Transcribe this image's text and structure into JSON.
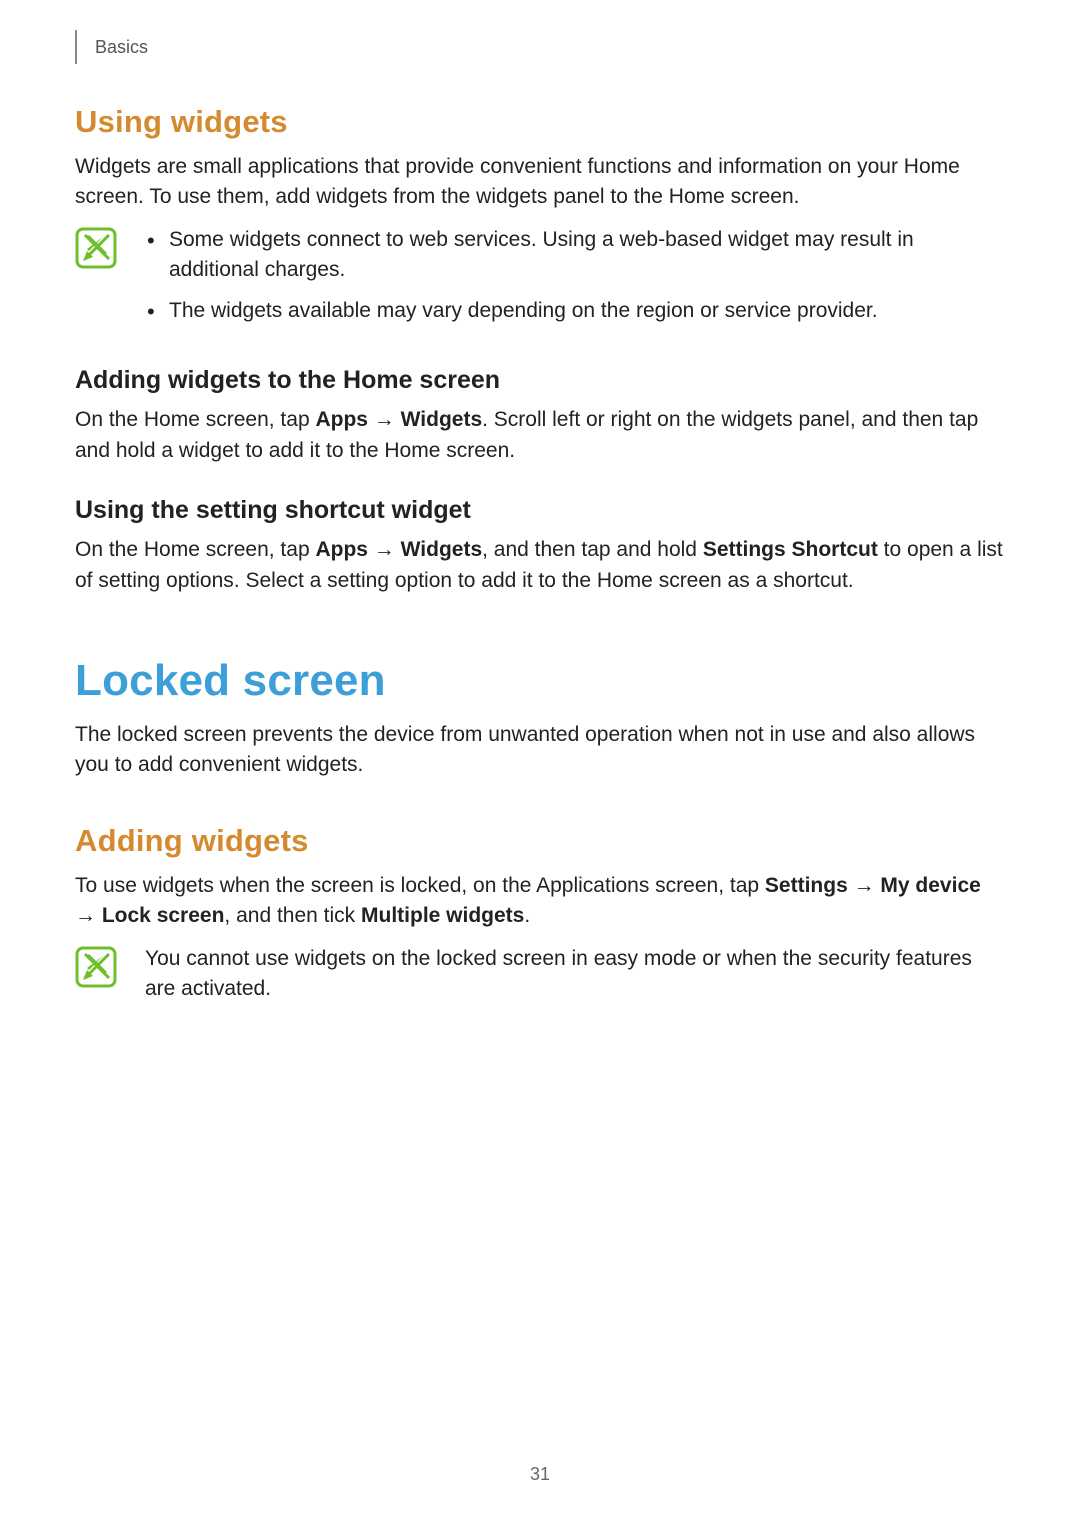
{
  "chapter": "Basics",
  "page_number": "31",
  "using_widgets": {
    "heading": "Using widgets",
    "intro": "Widgets are small applications that provide convenient functions and information on your Home screen. To use them, add widgets from the widgets panel to the Home screen.",
    "note_items": [
      "Some widgets connect to web services. Using a web-based widget may result in additional charges.",
      "The widgets available may vary depending on the region or service provider."
    ],
    "adding": {
      "heading": "Adding widgets to the Home screen",
      "text_pre": "On the Home screen, tap ",
      "apps": "Apps",
      "arrow": " → ",
      "widgets": "Widgets",
      "text_post": ". Scroll left or right on the widgets panel, and then tap and hold a widget to add it to the Home screen."
    },
    "shortcut": {
      "heading": "Using the setting shortcut widget",
      "text_pre": "On the Home screen, tap ",
      "apps": "Apps",
      "arrow1": " → ",
      "widgets": "Widgets",
      "mid": ", and then tap and hold ",
      "settings_shortcut": "Settings Shortcut",
      "text_post": " to open a list of setting options. Select a setting option to add it to the Home screen as a shortcut."
    }
  },
  "locked_screen": {
    "heading": "Locked screen",
    "intro": "The locked screen prevents the device from unwanted operation when not in use and also allows you to add convenient widgets.",
    "adding_widgets": {
      "heading": "Adding widgets",
      "text_pre": "To use widgets when the screen is locked, on the Applications screen, tap ",
      "settings": "Settings",
      "arrow1": " → ",
      "my_device": "My device",
      "arrow2": " → ",
      "lock_screen": "Lock screen",
      "mid": ", and then tick ",
      "multiple_widgets": "Multiple widgets",
      "text_post": ".",
      "note": "You cannot use widgets on the locked screen in easy mode or when the security features are activated."
    }
  }
}
